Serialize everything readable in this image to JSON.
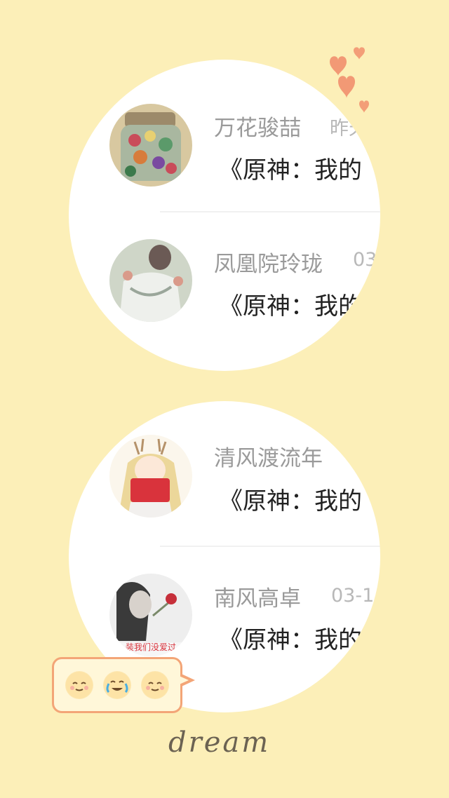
{
  "chats": [
    {
      "name": "万花骏喆",
      "time": "昨天",
      "preview": "《原神：我的"
    },
    {
      "name": "凤凰院玲珑",
      "time": "03",
      "preview": "《原神：我的"
    },
    {
      "name": "清风渡流年",
      "time": "",
      "preview": "《原神：我的"
    },
    {
      "name": "南风高卓",
      "time": "03-1",
      "preview": "《原神：我的"
    }
  ],
  "avatar_caption": "装我们没爱过",
  "emojis": [
    "smile-emoji",
    "cry-laugh-emoji",
    "smile-emoji"
  ],
  "signature": "dream",
  "colors": {
    "background": "#fcefb8",
    "accent": "#f3a577",
    "heart": "#f08a68"
  }
}
